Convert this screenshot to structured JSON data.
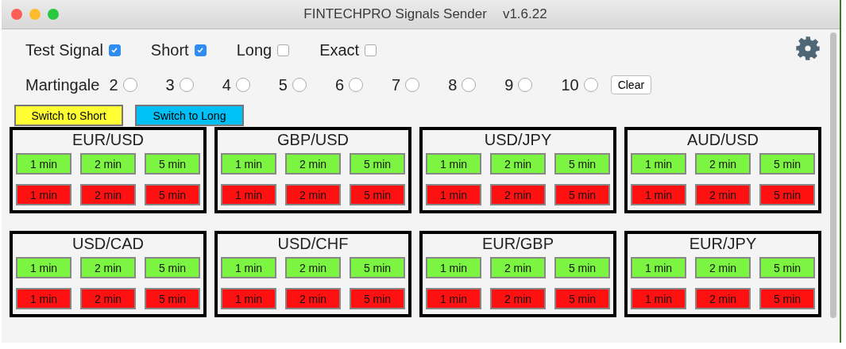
{
  "window": {
    "title": "FINTECHPRO Signals Sender",
    "version": "v1.6.22"
  },
  "options": [
    {
      "label": "Test Signal",
      "checked": true
    },
    {
      "label": "Short",
      "checked": true
    },
    {
      "label": "Long",
      "checked": false
    },
    {
      "label": "Exact",
      "checked": false
    }
  ],
  "martingale": {
    "label": "Martingale",
    "choices": [
      {
        "label": "2",
        "selected": false
      },
      {
        "label": "3",
        "selected": false
      },
      {
        "label": "4",
        "selected": false
      },
      {
        "label": "5",
        "selected": false
      },
      {
        "label": "6",
        "selected": false
      },
      {
        "label": "7",
        "selected": false
      },
      {
        "label": "8",
        "selected": false
      },
      {
        "label": "9",
        "selected": false
      },
      {
        "label": "10",
        "selected": false
      }
    ],
    "clear_button": "Clear"
  },
  "switch_buttons": [
    {
      "label": "Switch to Short",
      "kind": "short"
    },
    {
      "label": "Switch to Long",
      "kind": "long"
    }
  ],
  "pairs": [
    {
      "name": "EUR/USD",
      "rows": [
        {
          "kind": "up",
          "buttons": [
            "1 min",
            "2 min",
            "5 min"
          ]
        },
        {
          "kind": "down",
          "buttons": [
            "1 min",
            "2 min",
            "5 min"
          ]
        }
      ]
    },
    {
      "name": "GBP/USD",
      "rows": [
        {
          "kind": "up",
          "buttons": [
            "1 min",
            "2 min",
            "5 min"
          ]
        },
        {
          "kind": "down",
          "buttons": [
            "1 min",
            "2 min",
            "5 min"
          ]
        }
      ]
    },
    {
      "name": "USD/JPY",
      "rows": [
        {
          "kind": "up",
          "buttons": [
            "1 min",
            "2 min",
            "5 min"
          ]
        },
        {
          "kind": "down",
          "buttons": [
            "1 min",
            "2 min",
            "5 min"
          ]
        }
      ]
    },
    {
      "name": "AUD/USD",
      "rows": [
        {
          "kind": "up",
          "buttons": [
            "1 min",
            "2 min",
            "5 min"
          ]
        },
        {
          "kind": "down",
          "buttons": [
            "1 min",
            "2 min",
            "5 min"
          ]
        }
      ]
    },
    {
      "name": "USD/CAD",
      "rows": [
        {
          "kind": "up",
          "buttons": [
            "1 min",
            "2 min",
            "5 min"
          ]
        },
        {
          "kind": "down",
          "buttons": [
            "1 min",
            "2 min",
            "5 min"
          ]
        }
      ]
    },
    {
      "name": "USD/CHF",
      "rows": [
        {
          "kind": "up",
          "buttons": [
            "1 min",
            "2 min",
            "5 min"
          ]
        },
        {
          "kind": "down",
          "buttons": [
            "1 min",
            "2 min",
            "5 min"
          ]
        }
      ]
    },
    {
      "name": "EUR/GBP",
      "rows": [
        {
          "kind": "up",
          "buttons": [
            "1 min",
            "2 min",
            "5 min"
          ]
        },
        {
          "kind": "down",
          "buttons": [
            "1 min",
            "2 min",
            "5 min"
          ]
        }
      ]
    },
    {
      "name": "EUR/JPY",
      "rows": [
        {
          "kind": "up",
          "buttons": [
            "1 min",
            "2 min",
            "5 min"
          ]
        },
        {
          "kind": "down",
          "buttons": [
            "1 min",
            "2 min",
            "5 min"
          ]
        }
      ]
    }
  ]
}
